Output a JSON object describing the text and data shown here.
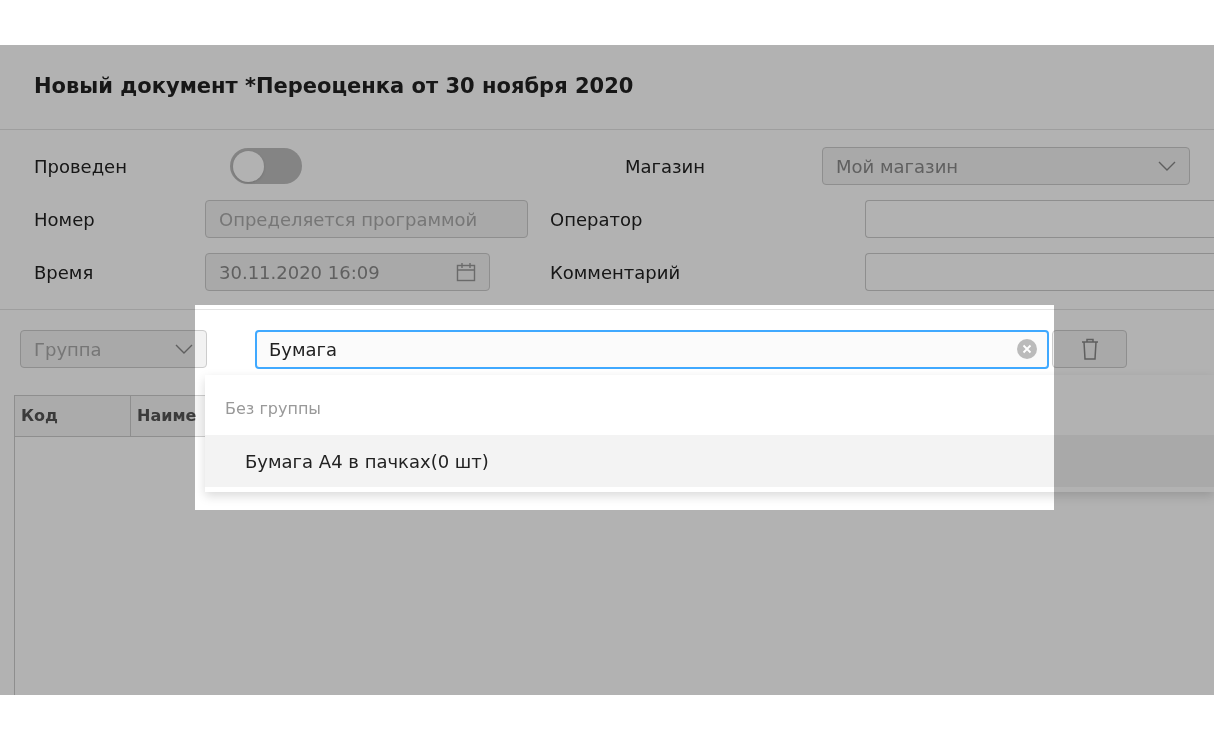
{
  "title": "Новый документ *Переоценка от 30 ноября 2020",
  "form": {
    "posted": {
      "label": "Проведен",
      "on": false
    },
    "number": {
      "label": "Номер",
      "placeholder": "Определяется программой"
    },
    "time": {
      "label": "Время",
      "value": "30.11.2020 16:09"
    },
    "store": {
      "label": "Магазин",
      "value": "Мой магазин"
    },
    "operator": {
      "label": "Оператор"
    },
    "comment": {
      "label": "Комментарий"
    }
  },
  "toolbar": {
    "group": {
      "placeholder": "Группа"
    },
    "search": {
      "value": "Бумага"
    }
  },
  "table": {
    "columns": [
      "Код",
      "Наиме"
    ]
  },
  "dropdown": {
    "group_header": "Без группы",
    "items": [
      {
        "label": "Бумага А4 в пачках(0 шт)",
        "selected": true
      }
    ]
  }
}
